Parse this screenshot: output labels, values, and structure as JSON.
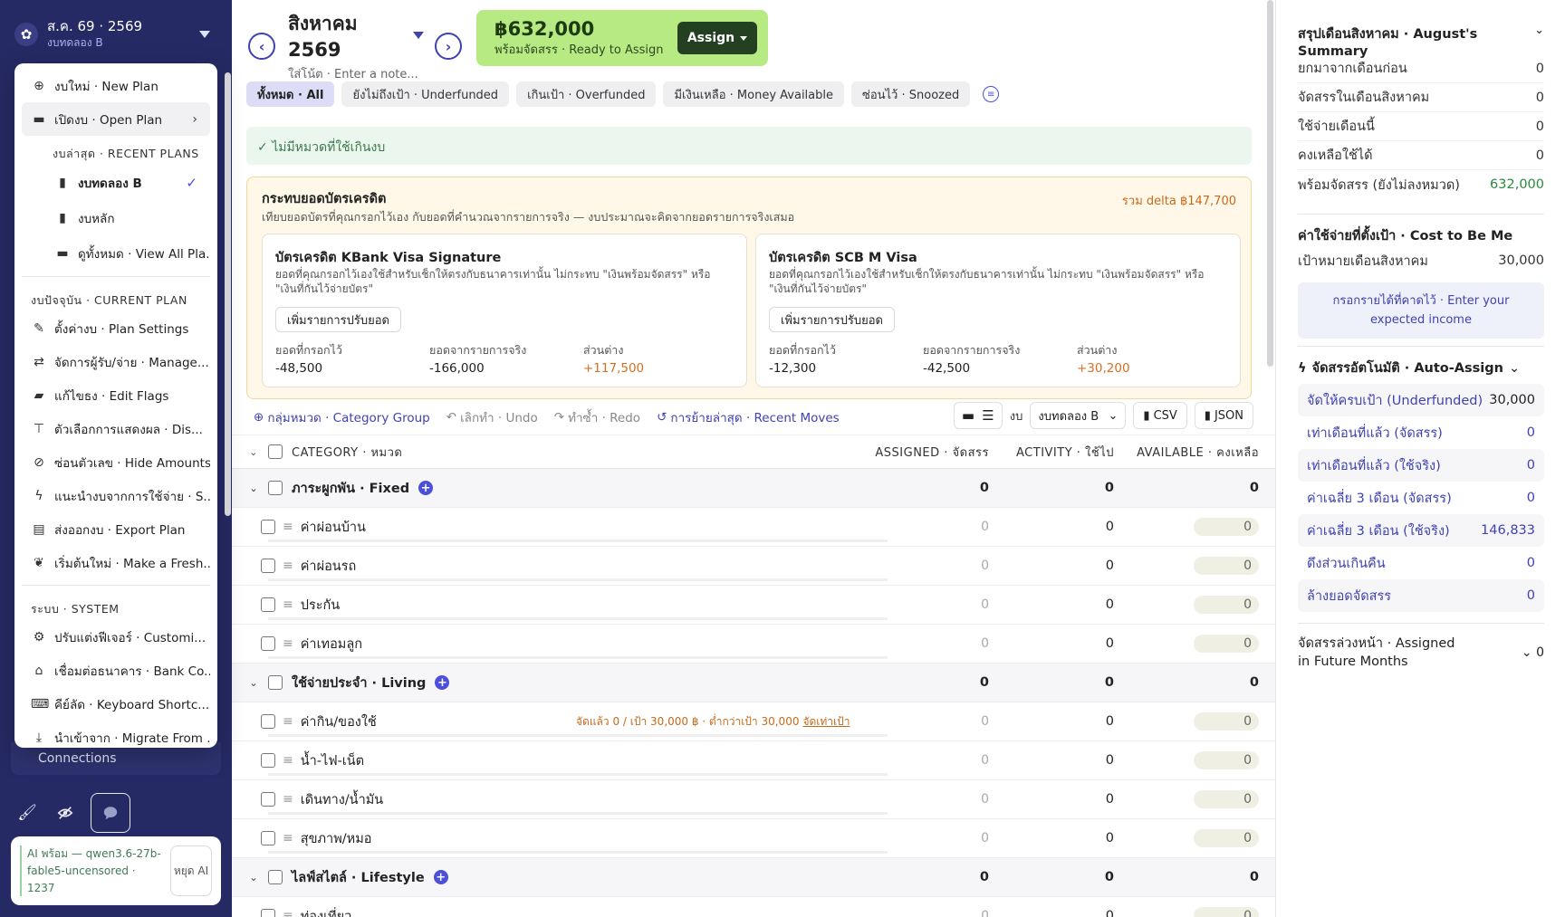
{
  "sidebar": {
    "month": "ส.ค. 69 · 2569",
    "plan": "งบทดลอง B",
    "connections": "Connections",
    "ai_status": "AI พร้อม — qwen3.6-27b-fable5-uncensored · 1237",
    "ai_stop": "หยุด AI"
  },
  "menu": {
    "new_plan": "งบใหม่ · New Plan",
    "open_plan": "เปิดงบ · Open Plan",
    "recent_head": "งบล่าสุด · RECENT PLANS",
    "recent": [
      "งบทดลอง B",
      "งบหลัก",
      "ดูทั้งหมด · View All Pla..."
    ],
    "current_head": "งบปัจจุบัน · CURRENT PLAN",
    "current": [
      "ตั้งค่างบ · Plan Settings",
      "จัดการผู้รับ/จ่าย · Manage...",
      "แก้ไขธง · Edit Flags",
      "ตัวเลือกการแสดงผล · Dis...",
      "ซ่อนตัวเลข · Hide Amounts",
      "แนะนำงบจากการใช้จ่าย · S...",
      "ส่งออกงบ · Export Plan",
      "เริ่มต้นใหม่ · Make a Fresh..."
    ],
    "system_head": "ระบบ · SYSTEM",
    "system": [
      "ปรับแต่งฟีเจอร์ · Customi...",
      "เชื่อมต่อธนาคาร · Bank Co...",
      "คีย์ลัด · Keyboard Shortc...",
      "นำเข้าจาก · Migrate From ..."
    ]
  },
  "header": {
    "month_title": "สิงหาคม 2569",
    "note_placeholder": "ใส่โน้ต · Enter a note...",
    "rta_amount": "฿632,000",
    "rta_label": "พร้อมจัดสรร · Ready to Assign",
    "assign": "Assign"
  },
  "filters": [
    "ทั้งหมด · All",
    "ยังไม่ถึงเป้า · Underfunded",
    "เกินเป้า · Overfunded",
    "มีเงินเหลือ · Money Available",
    "ซ่อนไว้ · Snoozed"
  ],
  "no_overspend": "ไม่มีหมวดที่ใช้เกินงบ",
  "credit": {
    "title": "กระทบยอดบัตรเครดิต",
    "desc": "เทียบยอดบัตรที่คุณกรอกไว้เอง กับยอดที่คำนวณจากรายการจริง — งบประมาณจะคิดจากยอดรายการจริงเสมอ",
    "total": "รวม delta ฿147,700",
    "card_desc": "ยอดที่คุณกรอกไว้เองใช้สำหรับเช็กให้ตรงกับธนาคารเท่านั้น ไม่กระทบ \"เงินพร้อมจัดสรร\" หรือ \"เงินที่กันไว้จ่ายบัตร\"",
    "adjust": "เพิ่มรายการปรับยอด",
    "col_entered": "ยอดที่กรอกไว้",
    "col_actual": "ยอดจากรายการจริง",
    "col_diff": "ส่วนต่าง",
    "cards": [
      {
        "name": "บัตรเครดิต KBank Visa Signature",
        "entered": "-48,500",
        "actual": "-166,000",
        "diff": "+117,500"
      },
      {
        "name": "บัตรเครดิต SCB M Visa",
        "entered": "-12,300",
        "actual": "-42,500",
        "diff": "+30,200"
      }
    ]
  },
  "toolbar": {
    "group": "กลุ่มหมวด · Category Group",
    "undo": "เลิกทำ · Undo",
    "redo": "ทำซ้ำ · Redo",
    "recent": "การย้ายล่าสุด · Recent Moves",
    "plan_label": "งบ",
    "plan_value": "งบทดลอง B",
    "csv": "CSV",
    "json": "JSON"
  },
  "table": {
    "h_cat": "CATEGORY · หมวด",
    "h_ass": "ASSIGNED · จัดสรร",
    "h_act": "ACTIVITY · ใช้ไป",
    "h_av": "AVAILABLE · คงเหลือ",
    "groups": [
      {
        "name": "ภาระผูกพัน · Fixed",
        "assigned": "0",
        "activity": "0",
        "available": "0",
        "items": [
          {
            "name": "ค่าผ่อนบ้าน",
            "assigned": "0",
            "activity": "0",
            "available": "0"
          },
          {
            "name": "ค่าผ่อนรถ",
            "assigned": "0",
            "activity": "0",
            "available": "0"
          },
          {
            "name": "ประกัน",
            "assigned": "0",
            "activity": "0",
            "available": "0"
          },
          {
            "name": "ค่าเทอมลูก",
            "assigned": "0",
            "activity": "0",
            "available": "0"
          }
        ]
      },
      {
        "name": "ใช้จ่ายประจำ · Living",
        "assigned": "0",
        "activity": "0",
        "available": "0",
        "items": [
          {
            "name": "ค่ากิน/ของใช้",
            "assigned": "0",
            "activity": "0",
            "available": "0",
            "note": "จัดแล้ว 0 / เป้า 30,000 ฿ · ต่ำกว่าเป้า 30,000",
            "note_link": "จัดเท่าเป้า"
          },
          {
            "name": "น้ำ-ไฟ-เน็ต",
            "assigned": "0",
            "activity": "0",
            "available": "0"
          },
          {
            "name": "เดินทาง/น้ำมัน",
            "assigned": "0",
            "activity": "0",
            "available": "0"
          },
          {
            "name": "สุขภาพ/หมอ",
            "assigned": "0",
            "activity": "0",
            "available": "0"
          }
        ]
      },
      {
        "name": "ไลฟ์สไตล์ · Lifestyle",
        "assigned": "0",
        "activity": "0",
        "available": "0",
        "items": [
          {
            "name": "ท่องเที่ยว",
            "assigned": "0",
            "activity": "0",
            "available": "0"
          }
        ]
      }
    ]
  },
  "summary": {
    "title": "สรุปเดือนสิงหาคม · August's Summary",
    "rows": [
      {
        "label": "ยกมาจากเดือนก่อน",
        "value": "0"
      },
      {
        "label": "จัดสรรในเดือนสิงหาคม",
        "value": "0"
      },
      {
        "label": "ใช้จ่ายเดือนนี้",
        "value": "0"
      },
      {
        "label": "คงเหลือใช้ได้",
        "value": "0"
      },
      {
        "label": "พร้อมจัดสรร (ยังไม่ลงหมวด)",
        "value": "632,000"
      }
    ],
    "cost_title": "ค่าใช้จ่ายที่ตั้งเป้า · Cost to Be Me",
    "cost_label": "เป้าหมายเดือนสิงหาคม",
    "cost_value": "30,000",
    "income_btn": "กรอกรายได้ที่คาดไว้ · Enter your expected income",
    "auto_title": "จัดสรรอัตโนมัติ · Auto-Assign",
    "auto": [
      {
        "label": "จัดให้ครบเป้า (Underfunded)",
        "value": "30,000"
      },
      {
        "label": "เท่าเดือนที่แล้ว (จัดสรร)",
        "value": "0"
      },
      {
        "label": "เท่าเดือนที่แล้ว (ใช้จริง)",
        "value": "0"
      },
      {
        "label": "ค่าเฉลี่ย 3 เดือน (จัดสรร)",
        "value": "0"
      },
      {
        "label": "ค่าเฉลี่ย 3 เดือน (ใช้จริง)",
        "value": "146,833"
      },
      {
        "label": "ดึงส่วนเกินคืน",
        "value": "0"
      },
      {
        "label": "ล้างยอดจัดสรร",
        "value": "0"
      }
    ],
    "future_title": "จัดสรรล่วงหน้า · Assigned in Future Months",
    "future_value": "0"
  }
}
